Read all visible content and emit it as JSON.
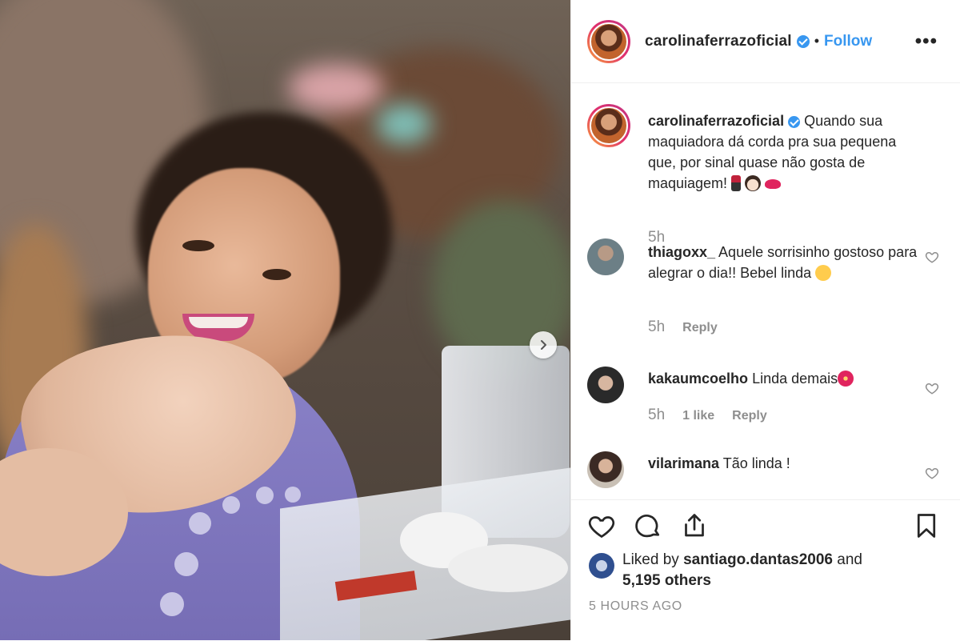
{
  "post": {
    "username": "carolinaferrazoficial",
    "follow_label": "Follow",
    "more_label": "•••",
    "separator": "•"
  },
  "caption": {
    "username": "carolinaferrazoficial",
    "text": "Quando sua maquiadora dá corda pra sua pequena que, por sinal quase não gosta de maquiagem!",
    "time": "5h"
  },
  "comments": [
    {
      "username": "thiagoxx_",
      "text": "Aquele sorrisinho gostoso para alegrar o dia!! Bebel linda",
      "time": "5h",
      "likes": "",
      "reply": "Reply"
    },
    {
      "username": "kakaumcoelho",
      "text": "Linda demais",
      "time": "5h",
      "likes": "1 like",
      "reply": "Reply"
    },
    {
      "username": "vilarimana",
      "text": "Tão linda !",
      "time": "",
      "likes": "",
      "reply": ""
    }
  ],
  "likes": {
    "prefix": "Liked by",
    "user": "santiago.dantas2006",
    "and": "and",
    "others": "5,195 others"
  },
  "timestamp": "5 HOURS AGO",
  "colors": {
    "accent": "#3897f0",
    "text": "#262626",
    "muted": "#8e8e8e",
    "border": "#efefef"
  }
}
